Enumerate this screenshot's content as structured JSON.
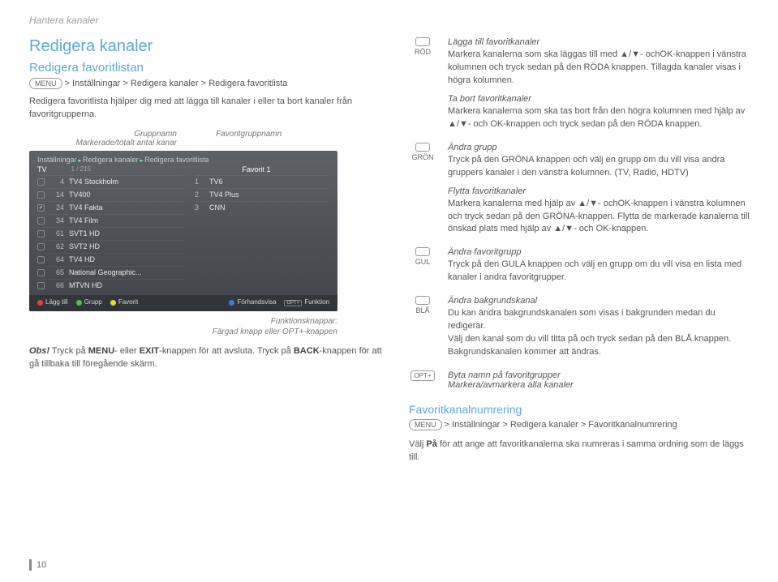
{
  "page_header": "Hantera kanaler",
  "title": "Redigera kanaler",
  "subtitle": "Redigera favoritlistan",
  "menu_label": "MENU",
  "path1": " > Inställningar > Redigera kanaler > Redigera favoritlista",
  "intro": "Redigera favoritlista hjälper dig med att lägga till kanaler i eller ta bort kanaler från favoritgrupperna.",
  "anno_groupname": "Gruppnamn",
  "anno_marked": "Markerade/totalt antal kanar",
  "anno_favgroupname": "Favoritgruppnamn",
  "below_anno_1": "Funktionsknappar:",
  "below_anno_2": "Färgad knapp eller OPT+-knappen",
  "obs_label": "Obs!",
  "obs_text_1": " Tryck på ",
  "obs_menu": "MENU",
  "obs_text_2": "- eller ",
  "obs_exit": "EXIT",
  "obs_text_3": "-knappen för att avsluta. Tryck på ",
  "obs_back": "BACK",
  "obs_text_4": "-knappen för att gå tillbaka till föregående skärm.",
  "ss": {
    "bc1": "Inställningar",
    "bc2": "Redigera kanaler",
    "bc3": "Redigera favoritlista",
    "group": "TV",
    "count": "1 / 215",
    "favgroup": "Favorit 1",
    "left": [
      {
        "chk": "",
        "num": "4",
        "name": "TV4 Stockholm"
      },
      {
        "chk": "",
        "num": "14",
        "name": "TV400"
      },
      {
        "chk": "✓",
        "num": "24",
        "name": "TV4 Fakta"
      },
      {
        "chk": "",
        "num": "34",
        "name": "TV4 Film"
      },
      {
        "chk": "",
        "num": "61",
        "name": "SVT1 HD"
      },
      {
        "chk": "",
        "num": "62",
        "name": "SVT2 HD"
      },
      {
        "chk": "",
        "num": "64",
        "name": "TV4 HD"
      },
      {
        "chk": "",
        "num": "65",
        "name": "National Geographic..."
      },
      {
        "chk": "",
        "num": "66",
        "name": "MTVN HD"
      }
    ],
    "right": [
      {
        "num": "1",
        "name": "TV6"
      },
      {
        "num": "2",
        "name": "TV4 Plus"
      },
      {
        "num": "3",
        "name": "CNN"
      }
    ],
    "foot_add": "Lägg till",
    "foot_group": "Grupp",
    "foot_fav": "Favorit",
    "foot_preview": "Förhandsvisa",
    "foot_opt": "OPT+",
    "foot_func": "Funktion"
  },
  "keys": {
    "red_label": "RÖD",
    "red_t1": "Lägga till favoritkanaler",
    "red_b1": "Markera kanalerna som ska läggas till med ▲/▼- ochOK-knappen i vänstra kolumnen och tryck sedan på den RÖDA knappen. Tillagda kanaler visas i högra kolumnen.",
    "red_t2": "Ta bort favoritkanaler",
    "red_b2": "Markera kanalerna som ska tas bort från den högra kolumnen med hjälp av ▲/▼- och OK-knappen och tryck sedan på den RÖDA knappen.",
    "green_label": "GRÖN",
    "green_t1": "Ändra grupp",
    "green_b1": "Tryck på den GRÖNA knappen och välj en grupp om du vill visa andra gruppers kanaler i den vänstra kolumnen. (TV, Radio, HDTV)",
    "green_t2": "Flytta favoritkanaler",
    "green_b2": "Markera kanalerna med hjälp av ▲/▼- ochOK-knappen i vänstra kolumnen och tryck sedan på den GRÖNA-knappen. Flytta de markerade kanalerna till önskad plats med hjälp av ▲/▼- och OK-knappen.",
    "yellow_label": "GUL",
    "yellow_t": "Ändra favoritgrupp",
    "yellow_b": "Tryck på den GULA knappen och välj en grupp om du vill visa en lista med kanaler i andra favoritgrupper.",
    "blue_label": "BLÅ",
    "blue_t": "Ändra bakgrundskanal",
    "blue_b": "Du kan ändra bakgrundskanalen som visas i bakgrunden medan du redigerar.\nVälj den kanal som du vill titta på och tryck sedan på den BLÅ knappen. Bakgrundskanalen kommer att ändras.",
    "opt_label": "OPT+",
    "opt_t": "Byta namn på favoritgrupper\nMarkera/avmarkera alla kanaler"
  },
  "h3": "Favoritkanalnumrering",
  "path2": " > Inställningar > Redigera kanaler > Favoritkanalnumrering",
  "bottom_1": "Välj ",
  "bottom_pa": "På",
  "bottom_2": " för att ange att favoritkanalerna ska numreras i samma ordning som de läggs till.",
  "page_num": "10"
}
